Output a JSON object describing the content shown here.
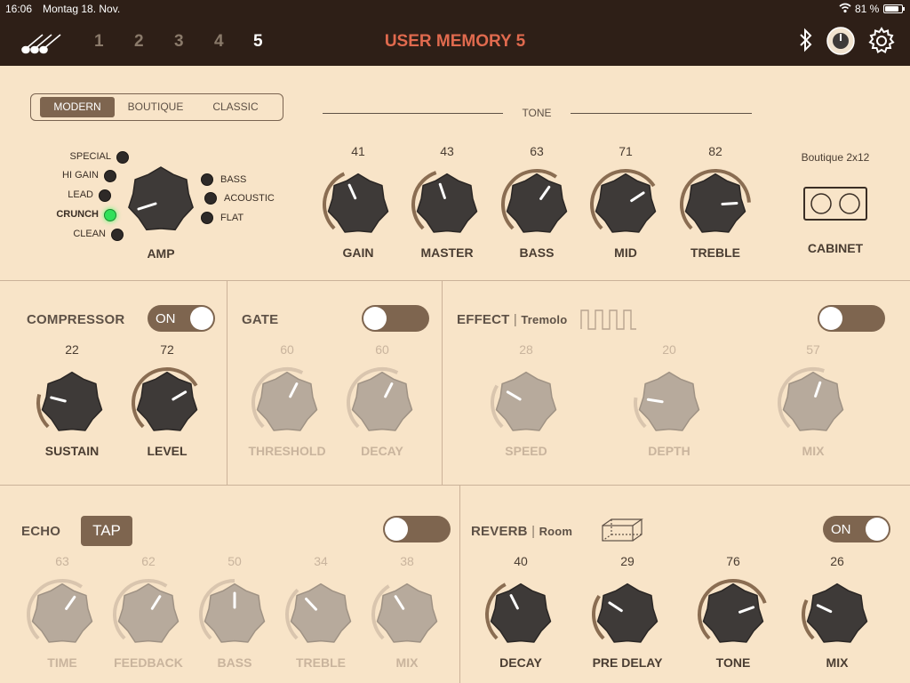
{
  "status": {
    "time": "16:06",
    "date": "Montag 18. Nov.",
    "battery_pct": "81 %",
    "battery_level": 0.81
  },
  "header": {
    "memories": [
      "1",
      "2",
      "3",
      "4",
      "5"
    ],
    "active_memory": "5",
    "title": "USER MEMORY 5"
  },
  "amp_section": {
    "modes": [
      "MODERN",
      "BOUTIQUE",
      "CLASSIC"
    ],
    "active_mode": "MODERN",
    "left_types": [
      "SPECIAL",
      "HI GAIN",
      "LEAD",
      "CRUNCH",
      "CLEAN"
    ],
    "right_types": [
      "BASS",
      "ACOUSTIC",
      "FLAT"
    ],
    "active_type": "CRUNCH",
    "amp_label": "AMP",
    "tone_label": "TONE",
    "cabinet_name": "Boutique 2x12",
    "cabinet_label": "CABINET",
    "knobs": [
      {
        "label": "GAIN",
        "value": "41"
      },
      {
        "label": "MASTER",
        "value": "43"
      },
      {
        "label": "BASS",
        "value": "63"
      },
      {
        "label": "MID",
        "value": "71"
      },
      {
        "label": "TREBLE",
        "value": "82"
      }
    ]
  },
  "compressor": {
    "title": "COMPRESSOR",
    "toggle_label": "ON",
    "knobs": [
      {
        "label": "SUSTAIN",
        "value": "22"
      },
      {
        "label": "LEVEL",
        "value": "72"
      }
    ]
  },
  "gate": {
    "title": "GATE",
    "knobs": [
      {
        "label": "THRESHOLD",
        "value": "60"
      },
      {
        "label": "DECAY",
        "value": "60"
      }
    ]
  },
  "effect": {
    "title": "EFFECT",
    "type": "Tremolo",
    "knobs": [
      {
        "label": "SPEED",
        "value": "28"
      },
      {
        "label": "DEPTH",
        "value": "20"
      },
      {
        "label": "MIX",
        "value": "57"
      }
    ]
  },
  "echo": {
    "title": "ECHO",
    "tap_label": "TAP",
    "knobs": [
      {
        "label": "TIME",
        "value": "63"
      },
      {
        "label": "FEEDBACK",
        "value": "62"
      },
      {
        "label": "BASS",
        "value": "50"
      },
      {
        "label": "TREBLE",
        "value": "34"
      },
      {
        "label": "MIX",
        "value": "38"
      }
    ]
  },
  "reverb": {
    "title": "REVERB",
    "type": "Room",
    "toggle_label": "ON",
    "knobs": [
      {
        "label": "DECAY",
        "value": "40"
      },
      {
        "label": "PRE DELAY",
        "value": "29"
      },
      {
        "label": "TONE",
        "value": "76"
      },
      {
        "label": "MIX",
        "value": "26"
      }
    ]
  },
  "colors": {
    "background": "#f8e4c8",
    "header": "#2e1f17",
    "accent": "#7e654f",
    "title_red": "#e06a4e",
    "led_green": "#31e05a",
    "knob_dark": "#3e3a38"
  },
  "icons": [
    "guitars-logo-icon",
    "bluetooth-icon",
    "amp-knob-icon",
    "gear-icon",
    "wifi-icon",
    "battery-icon",
    "cabinet-icon",
    "square-wave-icon",
    "room-box-icon"
  ]
}
